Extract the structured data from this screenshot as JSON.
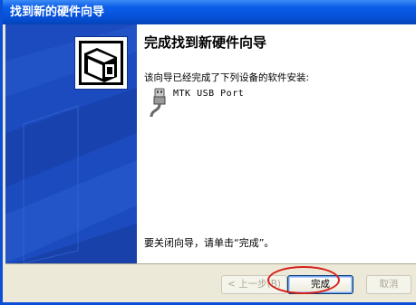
{
  "window": {
    "title": "找到新的硬件向导"
  },
  "wizard": {
    "heading": "完成找到新硬件向导",
    "intro": "该向导已经完成了下列设备的软件安装:",
    "device_name": "MTK USB Port",
    "footer": "要关闭向导，请单击“完成”。"
  },
  "buttons": {
    "back": "< 上一步(B)",
    "finish": "完成",
    "cancel": "取消"
  },
  "colors": {
    "titlebar": "#0a5de8",
    "sidebar": "#1c4bbf",
    "highlight": "#d8201a"
  },
  "icons": {
    "wizard_logo": "hardware-wizard-icon",
    "device": "usb-plug-icon"
  }
}
